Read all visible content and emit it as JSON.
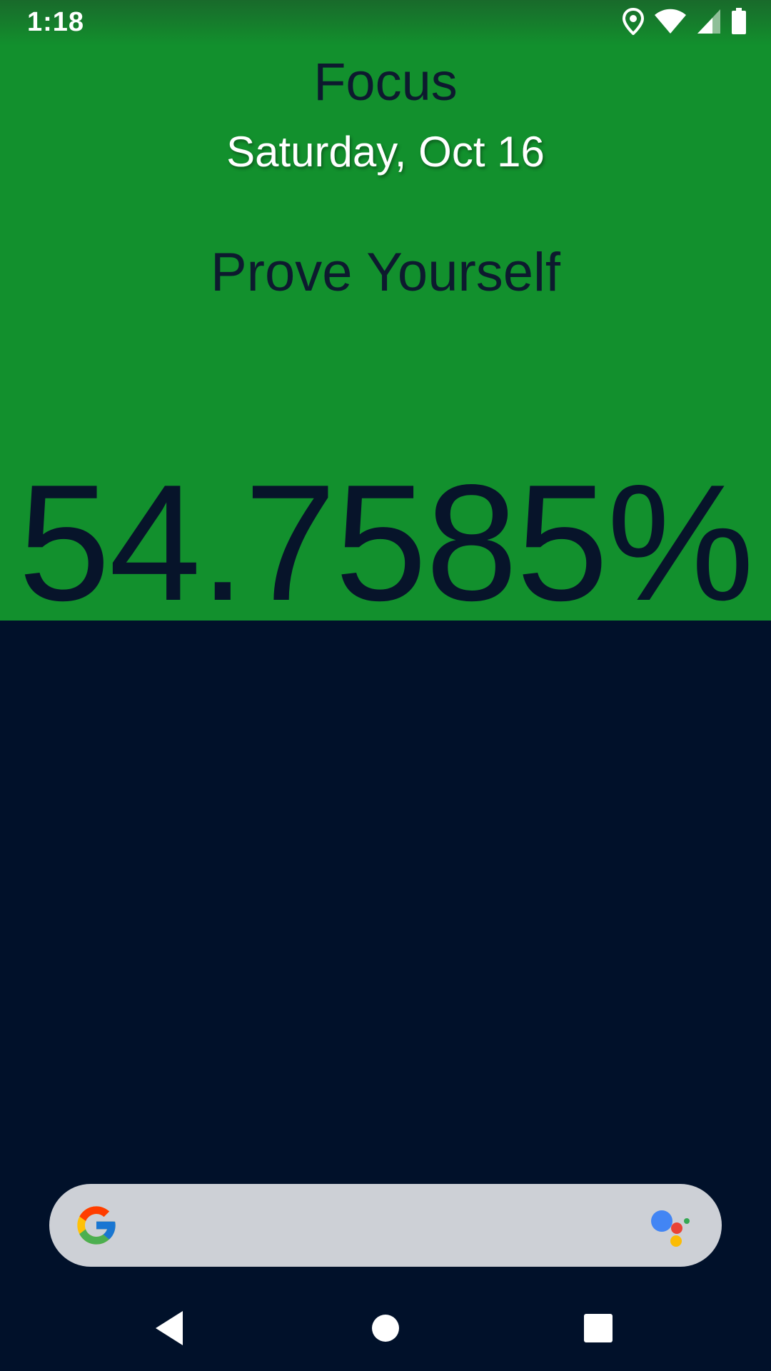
{
  "status_bar": {
    "time": "1:18",
    "icons": [
      "location-icon",
      "wifi-icon",
      "signal-icon",
      "battery-icon"
    ]
  },
  "app": {
    "title": "Focus",
    "date": "Saturday, Oct 16",
    "motto": "Prove Yourself",
    "percent_text": "54.7585%"
  },
  "search": {
    "icons": [
      "google-g-icon",
      "google-assistant-icon"
    ]
  },
  "nav": {
    "buttons": [
      "back-icon",
      "home-icon",
      "recents-icon"
    ]
  },
  "colors": {
    "green": "#12902d",
    "navy": "#01112a",
    "search_bg": "#cdd0d6"
  }
}
